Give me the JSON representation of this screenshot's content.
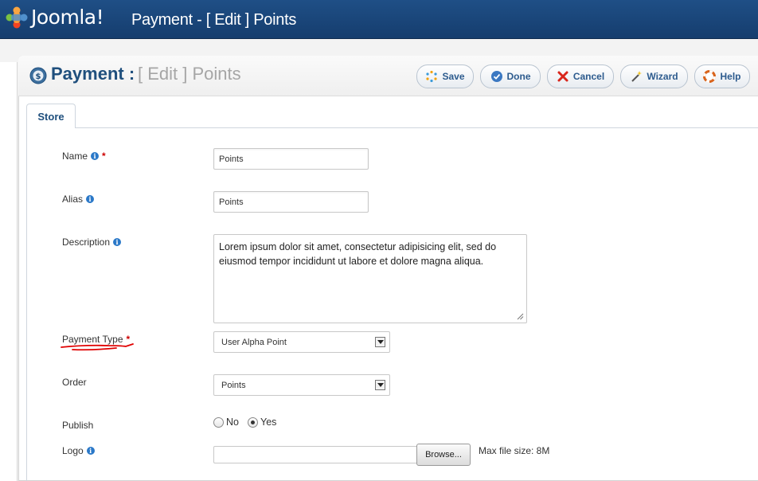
{
  "app": {
    "logo_text": "Joomla!",
    "window_title": "Payment - [ Edit ] Points"
  },
  "header": {
    "title": "Payment :",
    "subtitle": "[ Edit ] Points",
    "icon": "payment-dollar-icon"
  },
  "toolbar": {
    "save": "Save",
    "done": "Done",
    "cancel": "Cancel",
    "wizard": "Wizard",
    "help": "Help"
  },
  "tabs": [
    {
      "label": "Store",
      "active": true
    }
  ],
  "form": {
    "name": {
      "label": "Name",
      "required": "*",
      "value": "Points"
    },
    "alias": {
      "label": "Alias",
      "value": "Points"
    },
    "description": {
      "label": "Description",
      "value": "Lorem ipsum dolor sit amet, consectetur adipisicing elit, sed do eiusmod tempor incididunt ut labore et dolore magna aliqua."
    },
    "payment_type": {
      "label": "Payment Type",
      "required": "*",
      "selected": "User Alpha Point"
    },
    "order": {
      "label": "Order",
      "selected": "Points"
    },
    "publish": {
      "label": "Publish",
      "options": [
        "No",
        "Yes"
      ],
      "selected": "Yes"
    },
    "logo": {
      "label": "Logo",
      "browse_label": "Browse...",
      "max_size_text": "Max file size: 8M"
    }
  },
  "colors": {
    "topbar": "#1a4679",
    "title_blue": "#1f4f7d",
    "required": "#cc0000",
    "annotation_underline": "#e00000"
  }
}
